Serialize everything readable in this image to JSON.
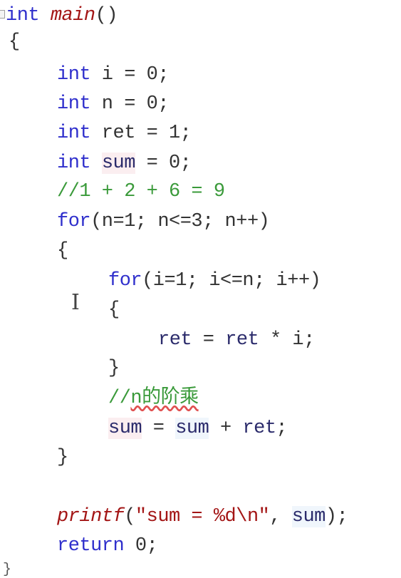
{
  "editor": {
    "language": "C",
    "lines": [
      {
        "tokens": [
          {
            "t": "int",
            "c": "kw"
          },
          {
            "t": " ",
            "c": "pn"
          },
          {
            "t": "main",
            "c": "fn"
          },
          {
            "t": "()",
            "c": "pn"
          }
        ]
      },
      {
        "tokens": [
          {
            "t": "{",
            "c": "pn"
          }
        ]
      },
      {
        "tokens": [
          {
            "t": "int",
            "c": "kw"
          },
          {
            "t": " i = 0;",
            "c": "pn"
          }
        ]
      },
      {
        "tokens": [
          {
            "t": "int",
            "c": "kw"
          },
          {
            "t": " n = 0;",
            "c": "pn"
          }
        ]
      },
      {
        "tokens": [
          {
            "t": "int",
            "c": "kw"
          },
          {
            "t": " ret = 1;",
            "c": "pn"
          }
        ]
      },
      {
        "tokens": [
          {
            "t": "int",
            "c": "kw"
          },
          {
            "t": " ",
            "c": "pn"
          },
          {
            "t": "sum",
            "c": "var hl"
          },
          {
            "t": " = 0;",
            "c": "pn"
          }
        ]
      },
      {
        "tokens": [
          {
            "t": "//1 + 2 + 6 = 9",
            "c": "cm"
          }
        ]
      },
      {
        "tokens": [
          {
            "t": "for",
            "c": "kw"
          },
          {
            "t": "(n=1; n<=3; n++)",
            "c": "pn"
          }
        ]
      },
      {
        "tokens": [
          {
            "t": "{",
            "c": "pn"
          }
        ]
      },
      {
        "tokens": [
          {
            "t": "for",
            "c": "kw"
          },
          {
            "t": "(i=1; i<=n; i++)",
            "c": "pn"
          }
        ]
      },
      {
        "tokens": [
          {
            "t": "{",
            "c": "pn"
          }
        ]
      },
      {
        "tokens": [
          {
            "t": "ret",
            "c": "var"
          },
          {
            "t": " = ",
            "c": "pn"
          },
          {
            "t": "ret",
            "c": "var"
          },
          {
            "t": " * i;",
            "c": "pn"
          }
        ]
      },
      {
        "tokens": [
          {
            "t": "}",
            "c": "pn"
          }
        ]
      },
      {
        "tokens": [
          {
            "t": "//",
            "c": "cm"
          },
          {
            "t": "n的阶乘",
            "c": "cm squiggle"
          }
        ]
      },
      {
        "tokens": [
          {
            "t": "sum",
            "c": "var hl"
          },
          {
            "t": " = ",
            "c": "pn"
          },
          {
            "t": "sum",
            "c": "var hl2"
          },
          {
            "t": " + ",
            "c": "pn"
          },
          {
            "t": "ret",
            "c": "var"
          },
          {
            "t": ";",
            "c": "pn"
          }
        ]
      },
      {
        "tokens": [
          {
            "t": "}",
            "c": "pn"
          }
        ]
      },
      {
        "tokens": []
      },
      {
        "tokens": [
          {
            "t": "printf",
            "c": "fn"
          },
          {
            "t": "(",
            "c": "pn"
          },
          {
            "t": "\"sum = %d\\n\"",
            "c": "str"
          },
          {
            "t": ", ",
            "c": "pn"
          },
          {
            "t": "sum",
            "c": "var hl2"
          },
          {
            "t": ");",
            "c": "pn"
          }
        ]
      },
      {
        "tokens": [
          {
            "t": "return",
            "c": "kw"
          },
          {
            "t": " 0;",
            "c": "pn"
          }
        ]
      }
    ],
    "closing_brace": "}"
  },
  "icons": {
    "fold_marker": "collapse-box",
    "cursor": "I"
  }
}
